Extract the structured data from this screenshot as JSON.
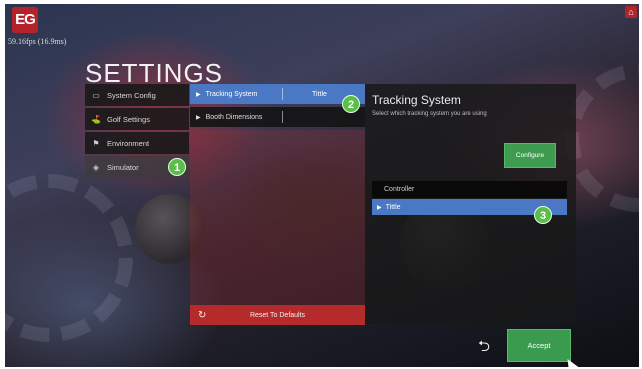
{
  "app": {
    "logo_text": "EG",
    "fps": "59.16fps (16.9ms)",
    "home_icon": "home-icon"
  },
  "page_title": "SETTINGS",
  "sidebar": {
    "items": [
      {
        "label": "System Config",
        "icon": "monitor-icon"
      },
      {
        "label": "Golf Settings",
        "icon": "golfer-icon"
      },
      {
        "label": "Environment",
        "icon": "flag-icon"
      },
      {
        "label": "Simulator",
        "icon": "diamond-icon",
        "selected": true
      }
    ]
  },
  "middle": {
    "rows": [
      {
        "label": "Tracking System",
        "value": "Tittle",
        "selected": true
      },
      {
        "label": "Booth Dimensions",
        "value": ""
      }
    ],
    "reset_label": "Reset To Defaults"
  },
  "detail": {
    "title": "Tracking System",
    "subtitle": "Select which tracking system you are using",
    "configure_label": "Configure",
    "list_header": "Controller",
    "list_items": [
      {
        "label": "Tittle",
        "selected": true
      }
    ]
  },
  "footer": {
    "accept_label": "Accept",
    "back_icon": "back-icon"
  },
  "callouts": [
    "1",
    "2",
    "3"
  ],
  "colors": {
    "accent_blue": "#4a78c4",
    "accept_green": "#3a9a4d",
    "reset_red": "#b52a2a",
    "brand_red": "#b5232a"
  }
}
